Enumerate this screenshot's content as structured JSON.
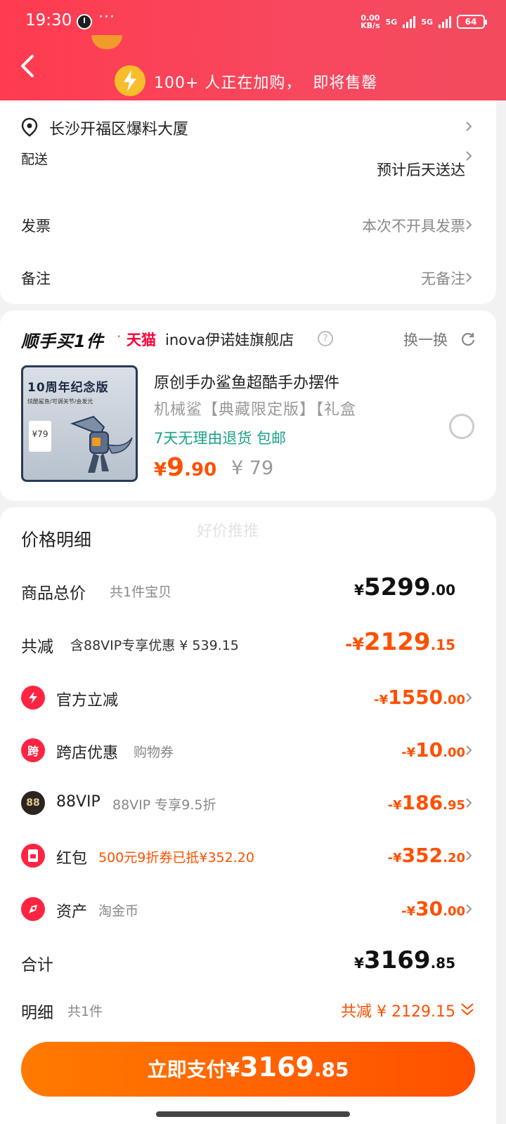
{
  "status": {
    "time": "19:30",
    "net_speed_value": "0.00",
    "net_speed_unit": "KB/s",
    "sig1": "5G",
    "sig2": "5G",
    "battery": "64"
  },
  "header": {
    "banner_text": "100+ 人正在加购，  即将售罄"
  },
  "address": {
    "location": "长沙开福区爆料大厦",
    "delivery_label": "配送",
    "delivery_value": "预计后天送达",
    "invoice_label": "发票",
    "invoice_value": "本次不开具发票",
    "remark_label": "备注",
    "remark_value": "无备注"
  },
  "addon": {
    "section_logo": "顺手买1件",
    "platform": "天猫",
    "shop": "inova伊诺娃旗舰店",
    "swap_label": "换一换",
    "thumb_badge": "10周年纪念版",
    "thumb_sub": "炫酷鲨鱼/可调关节/会发光",
    "thumb_price": "¥79",
    "title": "原创手办鲨鱼超酷手办摆件",
    "subtitle": "机械鲨【典藏限定版】【礼盒",
    "tags": "7天无理由退货  包邮",
    "price_currency": "¥",
    "price_int": "9",
    "price_dec": ".90",
    "orig_price": "¥ 79"
  },
  "price_detail": {
    "title": "价格明细",
    "watermark": "好价推推",
    "goods_total_label": "商品总价",
    "goods_total_sub": "共1件宝贝",
    "goods_total": {
      "cur": "¥",
      "int": "5299",
      "dec": ".00"
    },
    "reduce_label": "共减",
    "reduce_sub": "含88VIP专享优惠 ¥ 539.15",
    "reduce_total": {
      "cur": "-¥",
      "int": "2129",
      "dec": ".15"
    },
    "items": [
      {
        "label": "官方立减",
        "sub": "",
        "cur": "-¥",
        "int": "1550",
        "dec": ".00"
      },
      {
        "label": "跨店优惠",
        "sub": "购物券",
        "icon_text": "跨",
        "cur": "-¥",
        "int": "10",
        "dec": ".00"
      },
      {
        "label": "88VIP",
        "sub": "88VIP 专享9.5折",
        "icon_text": "88",
        "cur": "-¥",
        "int": "186",
        "dec": ".95"
      },
      {
        "label": "红包",
        "sub": "500元9折券已抵¥352.20",
        "cur": "-¥",
        "int": "352",
        "dec": ".20"
      },
      {
        "label": "资产",
        "sub": "淘金币",
        "cur": "-¥",
        "int": "30",
        "dec": ".00"
      }
    ],
    "sum_label": "合计",
    "sum": {
      "cur": "¥",
      "int": "3169",
      "dec": ".85"
    },
    "detail_label": "明细",
    "detail_sub": "共1件",
    "detail_reduce": "共减 ¥ 2129.15"
  },
  "pay": {
    "label": "立即支付",
    "cur": "¥",
    "int": "3169",
    "dec": ".85"
  },
  "colors": {
    "header_red": "#ff3b4f",
    "price_orange": "#ff5000",
    "tag_green": "#1aa28a"
  }
}
